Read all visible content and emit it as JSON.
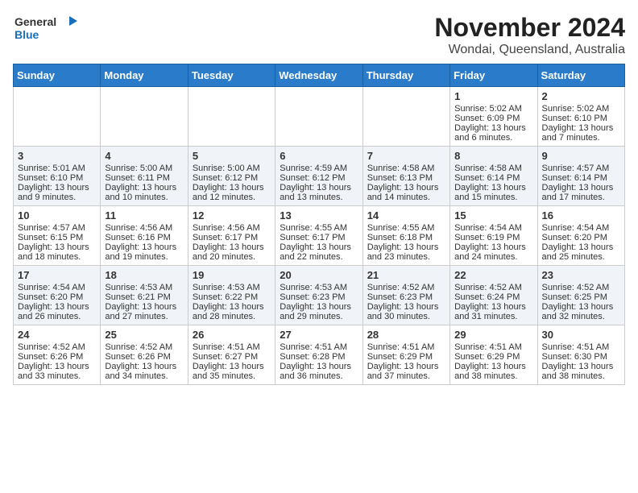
{
  "logo": {
    "general": "General",
    "blue": "Blue"
  },
  "header": {
    "month": "November 2024",
    "location": "Wondai, Queensland, Australia"
  },
  "days_of_week": [
    "Sunday",
    "Monday",
    "Tuesday",
    "Wednesday",
    "Thursday",
    "Friday",
    "Saturday"
  ],
  "weeks": [
    {
      "days": [
        {
          "date": "",
          "info": ""
        },
        {
          "date": "",
          "info": ""
        },
        {
          "date": "",
          "info": ""
        },
        {
          "date": "",
          "info": ""
        },
        {
          "date": "",
          "info": ""
        },
        {
          "date": "1",
          "sunrise": "Sunrise: 5:02 AM",
          "sunset": "Sunset: 6:09 PM",
          "daylight": "Daylight: 13 hours and 6 minutes."
        },
        {
          "date": "2",
          "sunrise": "Sunrise: 5:02 AM",
          "sunset": "Sunset: 6:10 PM",
          "daylight": "Daylight: 13 hours and 7 minutes."
        }
      ]
    },
    {
      "days": [
        {
          "date": "3",
          "sunrise": "Sunrise: 5:01 AM",
          "sunset": "Sunset: 6:10 PM",
          "daylight": "Daylight: 13 hours and 9 minutes."
        },
        {
          "date": "4",
          "sunrise": "Sunrise: 5:00 AM",
          "sunset": "Sunset: 6:11 PM",
          "daylight": "Daylight: 13 hours and 10 minutes."
        },
        {
          "date": "5",
          "sunrise": "Sunrise: 5:00 AM",
          "sunset": "Sunset: 6:12 PM",
          "daylight": "Daylight: 13 hours and 12 minutes."
        },
        {
          "date": "6",
          "sunrise": "Sunrise: 4:59 AM",
          "sunset": "Sunset: 6:12 PM",
          "daylight": "Daylight: 13 hours and 13 minutes."
        },
        {
          "date": "7",
          "sunrise": "Sunrise: 4:58 AM",
          "sunset": "Sunset: 6:13 PM",
          "daylight": "Daylight: 13 hours and 14 minutes."
        },
        {
          "date": "8",
          "sunrise": "Sunrise: 4:58 AM",
          "sunset": "Sunset: 6:14 PM",
          "daylight": "Daylight: 13 hours and 15 minutes."
        },
        {
          "date": "9",
          "sunrise": "Sunrise: 4:57 AM",
          "sunset": "Sunset: 6:14 PM",
          "daylight": "Daylight: 13 hours and 17 minutes."
        }
      ]
    },
    {
      "days": [
        {
          "date": "10",
          "sunrise": "Sunrise: 4:57 AM",
          "sunset": "Sunset: 6:15 PM",
          "daylight": "Daylight: 13 hours and 18 minutes."
        },
        {
          "date": "11",
          "sunrise": "Sunrise: 4:56 AM",
          "sunset": "Sunset: 6:16 PM",
          "daylight": "Daylight: 13 hours and 19 minutes."
        },
        {
          "date": "12",
          "sunrise": "Sunrise: 4:56 AM",
          "sunset": "Sunset: 6:17 PM",
          "daylight": "Daylight: 13 hours and 20 minutes."
        },
        {
          "date": "13",
          "sunrise": "Sunrise: 4:55 AM",
          "sunset": "Sunset: 6:17 PM",
          "daylight": "Daylight: 13 hours and 22 minutes."
        },
        {
          "date": "14",
          "sunrise": "Sunrise: 4:55 AM",
          "sunset": "Sunset: 6:18 PM",
          "daylight": "Daylight: 13 hours and 23 minutes."
        },
        {
          "date": "15",
          "sunrise": "Sunrise: 4:54 AM",
          "sunset": "Sunset: 6:19 PM",
          "daylight": "Daylight: 13 hours and 24 minutes."
        },
        {
          "date": "16",
          "sunrise": "Sunrise: 4:54 AM",
          "sunset": "Sunset: 6:20 PM",
          "daylight": "Daylight: 13 hours and 25 minutes."
        }
      ]
    },
    {
      "days": [
        {
          "date": "17",
          "sunrise": "Sunrise: 4:54 AM",
          "sunset": "Sunset: 6:20 PM",
          "daylight": "Daylight: 13 hours and 26 minutes."
        },
        {
          "date": "18",
          "sunrise": "Sunrise: 4:53 AM",
          "sunset": "Sunset: 6:21 PM",
          "daylight": "Daylight: 13 hours and 27 minutes."
        },
        {
          "date": "19",
          "sunrise": "Sunrise: 4:53 AM",
          "sunset": "Sunset: 6:22 PM",
          "daylight": "Daylight: 13 hours and 28 minutes."
        },
        {
          "date": "20",
          "sunrise": "Sunrise: 4:53 AM",
          "sunset": "Sunset: 6:23 PM",
          "daylight": "Daylight: 13 hours and 29 minutes."
        },
        {
          "date": "21",
          "sunrise": "Sunrise: 4:52 AM",
          "sunset": "Sunset: 6:23 PM",
          "daylight": "Daylight: 13 hours and 30 minutes."
        },
        {
          "date": "22",
          "sunrise": "Sunrise: 4:52 AM",
          "sunset": "Sunset: 6:24 PM",
          "daylight": "Daylight: 13 hours and 31 minutes."
        },
        {
          "date": "23",
          "sunrise": "Sunrise: 4:52 AM",
          "sunset": "Sunset: 6:25 PM",
          "daylight": "Daylight: 13 hours and 32 minutes."
        }
      ]
    },
    {
      "days": [
        {
          "date": "24",
          "sunrise": "Sunrise: 4:52 AM",
          "sunset": "Sunset: 6:26 PM",
          "daylight": "Daylight: 13 hours and 33 minutes."
        },
        {
          "date": "25",
          "sunrise": "Sunrise: 4:52 AM",
          "sunset": "Sunset: 6:26 PM",
          "daylight": "Daylight: 13 hours and 34 minutes."
        },
        {
          "date": "26",
          "sunrise": "Sunrise: 4:51 AM",
          "sunset": "Sunset: 6:27 PM",
          "daylight": "Daylight: 13 hours and 35 minutes."
        },
        {
          "date": "27",
          "sunrise": "Sunrise: 4:51 AM",
          "sunset": "Sunset: 6:28 PM",
          "daylight": "Daylight: 13 hours and 36 minutes."
        },
        {
          "date": "28",
          "sunrise": "Sunrise: 4:51 AM",
          "sunset": "Sunset: 6:29 PM",
          "daylight": "Daylight: 13 hours and 37 minutes."
        },
        {
          "date": "29",
          "sunrise": "Sunrise: 4:51 AM",
          "sunset": "Sunset: 6:29 PM",
          "daylight": "Daylight: 13 hours and 38 minutes."
        },
        {
          "date": "30",
          "sunrise": "Sunrise: 4:51 AM",
          "sunset": "Sunset: 6:30 PM",
          "daylight": "Daylight: 13 hours and 38 minutes."
        }
      ]
    }
  ]
}
